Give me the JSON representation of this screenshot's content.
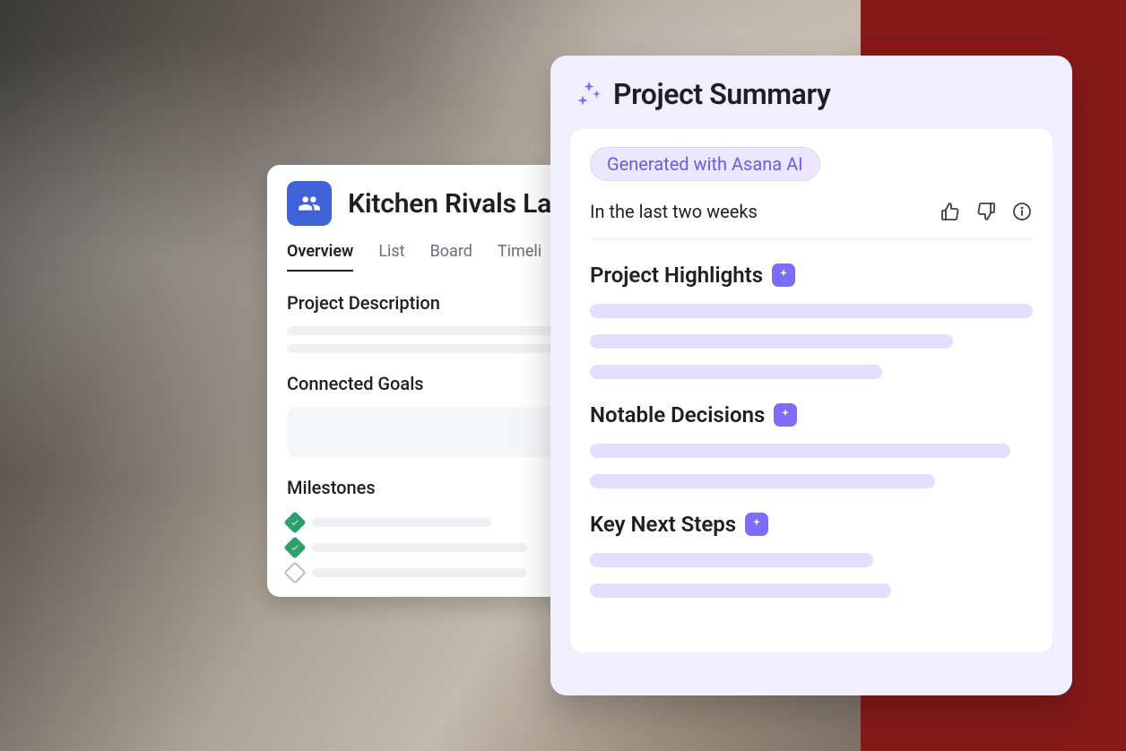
{
  "project": {
    "title_visible": "Kitchen Rivals La",
    "tabs": [
      {
        "label": "Overview",
        "active": true
      },
      {
        "label": "List",
        "active": false
      },
      {
        "label": "Board",
        "active": false
      },
      {
        "label": "Timeli",
        "active": false
      }
    ],
    "sections": {
      "description_label": "Project Description",
      "goals_label": "Connected Goals",
      "milestones_label": "Milestones"
    },
    "milestones": [
      {
        "status": "done"
      },
      {
        "status": "done"
      },
      {
        "status": "open"
      }
    ]
  },
  "summary": {
    "title": "Project Summary",
    "ai_badge": "Generated with Asana AI",
    "time_range": "In the last two weeks",
    "sections": {
      "highlights": "Project Highlights",
      "decisions": "Notable Decisions",
      "next_steps": "Key Next Steps"
    }
  },
  "colors": {
    "accent_red": "#861a1a",
    "project_icon": "#3f63d6",
    "lavender_bg": "#f1eeff",
    "lavender_badge": "#ece7ff",
    "purple_accent": "#7c6cf8",
    "milestone_done": "#2ba06a"
  }
}
